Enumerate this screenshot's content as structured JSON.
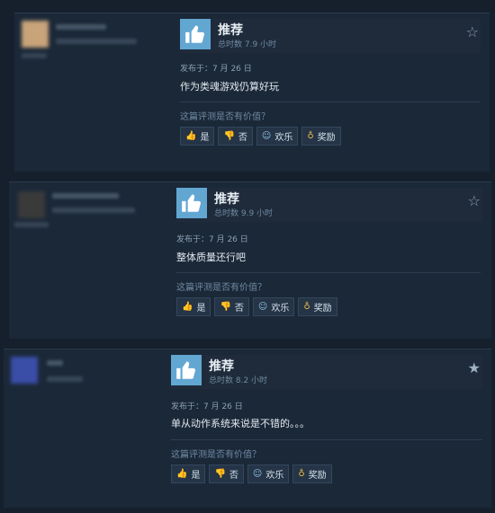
{
  "reviews": [
    {
      "recommend_label": "推荐",
      "hours": "总时数 7.9 小时",
      "posted": "发布于：7 月 26 日",
      "content": "作为类魂游戏仍算好玩",
      "helpful_question": "这篇评测是否有价值？",
      "buttons": {
        "yes": "是",
        "no": "否",
        "funny": "欢乐",
        "award": "奖励"
      },
      "avatar_color": "#c9a47a",
      "star_filled": false
    },
    {
      "recommend_label": "推荐",
      "hours": "总时数 9.9 小时",
      "posted": "发布于：7 月 26 日",
      "content": "整体质量还行吧",
      "helpful_question": "这篇评测是否有价值？",
      "buttons": {
        "yes": "是",
        "no": "否",
        "funny": "欢乐",
        "award": "奖励"
      },
      "avatar_color": "#3a3a3a",
      "star_filled": false
    },
    {
      "recommend_label": "推荐",
      "hours": "总时数 8.2 小时",
      "posted": "发布于：7 月 26 日",
      "content": "单从动作系统来说是不错的。。。",
      "helpful_question": "这篇评测是否有价值？",
      "buttons": {
        "yes": "是",
        "no": "否",
        "funny": "欢乐",
        "award": "奖励"
      },
      "avatar_color": "#3a4ea8",
      "star_filled": true
    }
  ],
  "colors": {
    "accent": "#62a6d2",
    "award": "#e7b84b"
  },
  "icons": {
    "thumb_up": "thumbs-up-icon",
    "thumb_down": "thumbs-down-icon",
    "funny": "smiley-icon",
    "award": "award-icon",
    "star": "star-icon"
  }
}
